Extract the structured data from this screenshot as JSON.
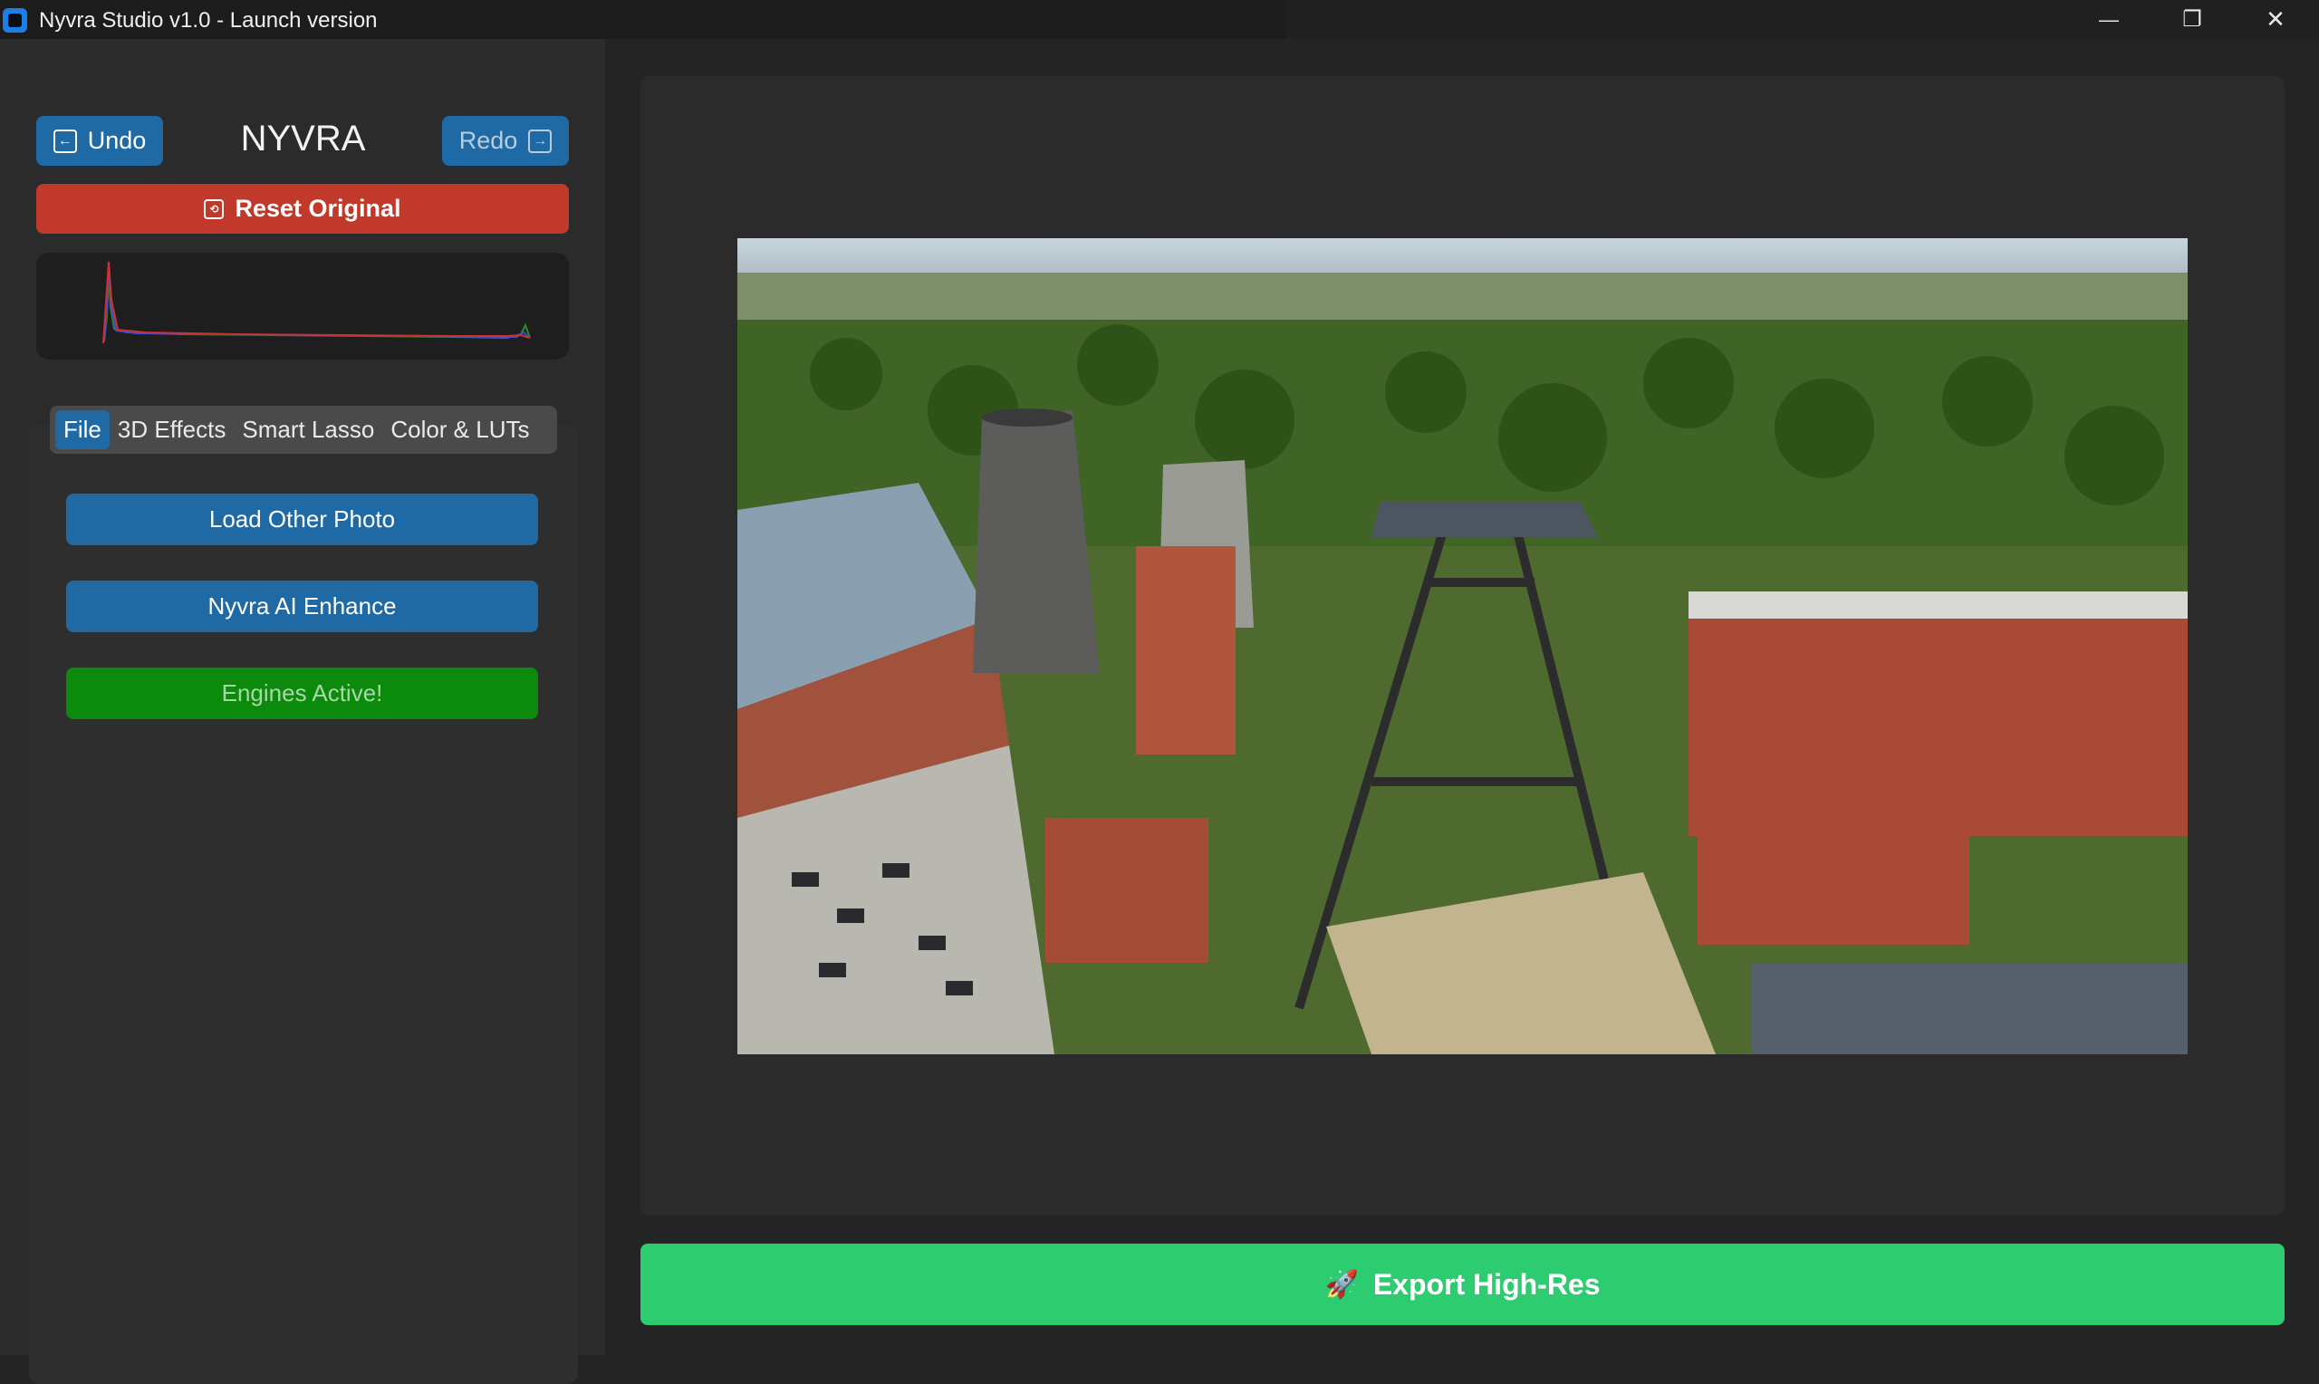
{
  "window": {
    "title": "Nyvra Studio v1.0 - Launch version",
    "minimize_glyph": "—",
    "maximize_glyph": "❐",
    "close_glyph": "✕"
  },
  "header": {
    "undo_label": "Undo",
    "redo_label": "Redo",
    "brand": "NYVRA",
    "reset_label": "Reset Original"
  },
  "tabs": [
    {
      "label": "File",
      "active": true
    },
    {
      "label": "3D Effects",
      "active": false
    },
    {
      "label": "Smart Lasso",
      "active": false
    },
    {
      "label": "Color & LUTs",
      "active": false
    }
  ],
  "file_panel": {
    "load_label": "Load Other Photo",
    "enhance_label": "Nyvra AI Enhance",
    "engines_label": "Engines Active!"
  },
  "export": {
    "label": "Export High-Res"
  },
  "colors": {
    "accent_blue": "#1f6aa5",
    "reset_red": "#c0392b",
    "engines_green": "#0b8a0b",
    "export_green": "#2ecc71"
  },
  "icons": {
    "undo": "arrow-left-box-icon",
    "redo": "arrow-right-box-icon",
    "reset": "restore-icon",
    "export": "rocket-icon"
  }
}
